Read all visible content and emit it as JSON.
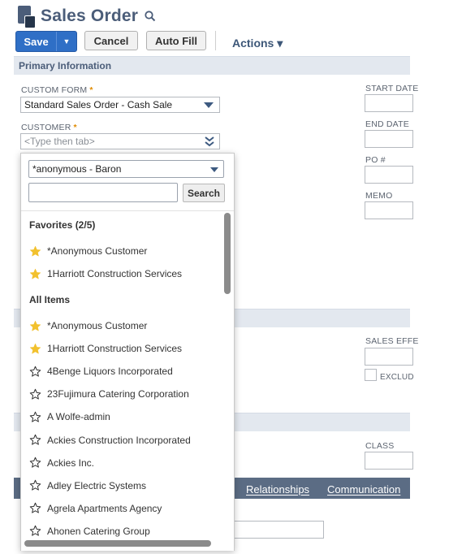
{
  "page": {
    "title": "Sales Order"
  },
  "toolbar": {
    "save_label": "Save",
    "cancel_label": "Cancel",
    "autofill_label": "Auto Fill",
    "actions_label": "Actions ▾"
  },
  "primary": {
    "section_title": "Primary Information",
    "custom_form": {
      "label": "CUSTOM FORM",
      "required": "*",
      "value": "Standard Sales Order - Cash Sale"
    },
    "customer": {
      "label": "CUSTOMER",
      "required": "*",
      "placeholder": "<Type then tab>"
    },
    "right_labels": {
      "start_date": "START DATE",
      "end_date": "END DATE",
      "po": "PO #",
      "memo": "MEMO"
    }
  },
  "sales": {
    "sales_effective": "SALES EFFE",
    "exclude": "EXCLUD"
  },
  "classification": {
    "class_label": "CLASS"
  },
  "tabs": {
    "relationships": "Relationships",
    "communication": "Communication"
  },
  "popup": {
    "selected_filter": "*anonymous - Baron",
    "search_value": "",
    "search_button": "Search",
    "favorites_header": "Favorites (2/5)",
    "favorites": [
      "*Anonymous Customer",
      "1Harriott Construction Services"
    ],
    "all_header": "All Items",
    "all_items": [
      {
        "name": "*Anonymous Customer",
        "starred": true
      },
      {
        "name": "1Harriott Construction Services",
        "starred": true
      },
      {
        "name": "4Benge Liquors Incorporated",
        "starred": false
      },
      {
        "name": "23Fujimura Catering Corporation",
        "starred": false
      },
      {
        "name": "A Wolfe-admin",
        "starred": false
      },
      {
        "name": "Ackies Construction Incorporated",
        "starred": false
      },
      {
        "name": "Ackies Inc.",
        "starred": false
      },
      {
        "name": "Adley Electric Systems",
        "starred": false
      },
      {
        "name": "Agrela Apartments Agency",
        "starred": false
      },
      {
        "name": "Ahonen Catering Group",
        "starred": false
      }
    ]
  },
  "colors": {
    "accent": "#2f6fc6",
    "header_text": "#4b5d79",
    "section_bg": "#e3e8ef",
    "tabs_bg": "#5b6c84",
    "star_filled": "#f2c12e",
    "required": "#e08b00"
  }
}
